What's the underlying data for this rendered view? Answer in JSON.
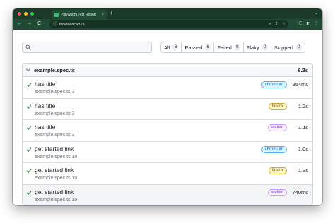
{
  "browser": {
    "tab_title": "Playwright Test Report",
    "tab_close": "×",
    "new_tab": "+",
    "tab_menu": "⌄",
    "url": "localhost:9323",
    "back_glyph": "←",
    "forward_glyph": "→",
    "reload_glyph": "C",
    "info_glyph": "ⓘ",
    "omnibox_icons": [
      "⌕",
      "⇪",
      "☆"
    ],
    "toolbar_icons": [
      "❒",
      "◧",
      "⋮"
    ],
    "traffic_lights": [
      "#ff5f57",
      "#febc2e",
      "#28c840"
    ]
  },
  "search": {
    "placeholder": "",
    "value": ""
  },
  "filters": [
    {
      "label": "All",
      "count": "6"
    },
    {
      "label": "Passed",
      "count": "6"
    },
    {
      "label": "Failed",
      "count": "0"
    },
    {
      "label": "Flaky",
      "count": "0"
    },
    {
      "label": "Skipped",
      "count": "0"
    }
  ],
  "suite": {
    "title": "example.spec.ts",
    "duration": "6.3s",
    "tests": [
      {
        "title": "has title",
        "location": "example.spec.ts:3",
        "project": "chromium",
        "duration": "954ms"
      },
      {
        "title": "has title",
        "location": "example.spec.ts:3",
        "project": "firefox",
        "duration": "1.2s"
      },
      {
        "title": "has title",
        "location": "example.spec.ts:3",
        "project": "webkit",
        "duration": "1.1s"
      },
      {
        "title": "get started link",
        "location": "example.spec.ts:10",
        "project": "chromium",
        "duration": "1.0s"
      },
      {
        "title": "get started link",
        "location": "example.spec.ts:10",
        "project": "firefox",
        "duration": "1.3s"
      },
      {
        "title": "get started link",
        "location": "example.spec.ts:10",
        "project": "webkit",
        "duration": "740ms"
      }
    ]
  },
  "colors": {
    "pass_check": "#1a7f37",
    "chromium_text": "#0969da",
    "chromium_bg": "#ddf4ff",
    "chromium_border": "#54aeff",
    "firefox_text": "#7d4e00",
    "firefox_bg": "#fff8c5",
    "firefox_border": "#d4a72c",
    "webkit_text": "#8250df",
    "webkit_bg": "#fbefff",
    "webkit_border": "#c297ff"
  }
}
